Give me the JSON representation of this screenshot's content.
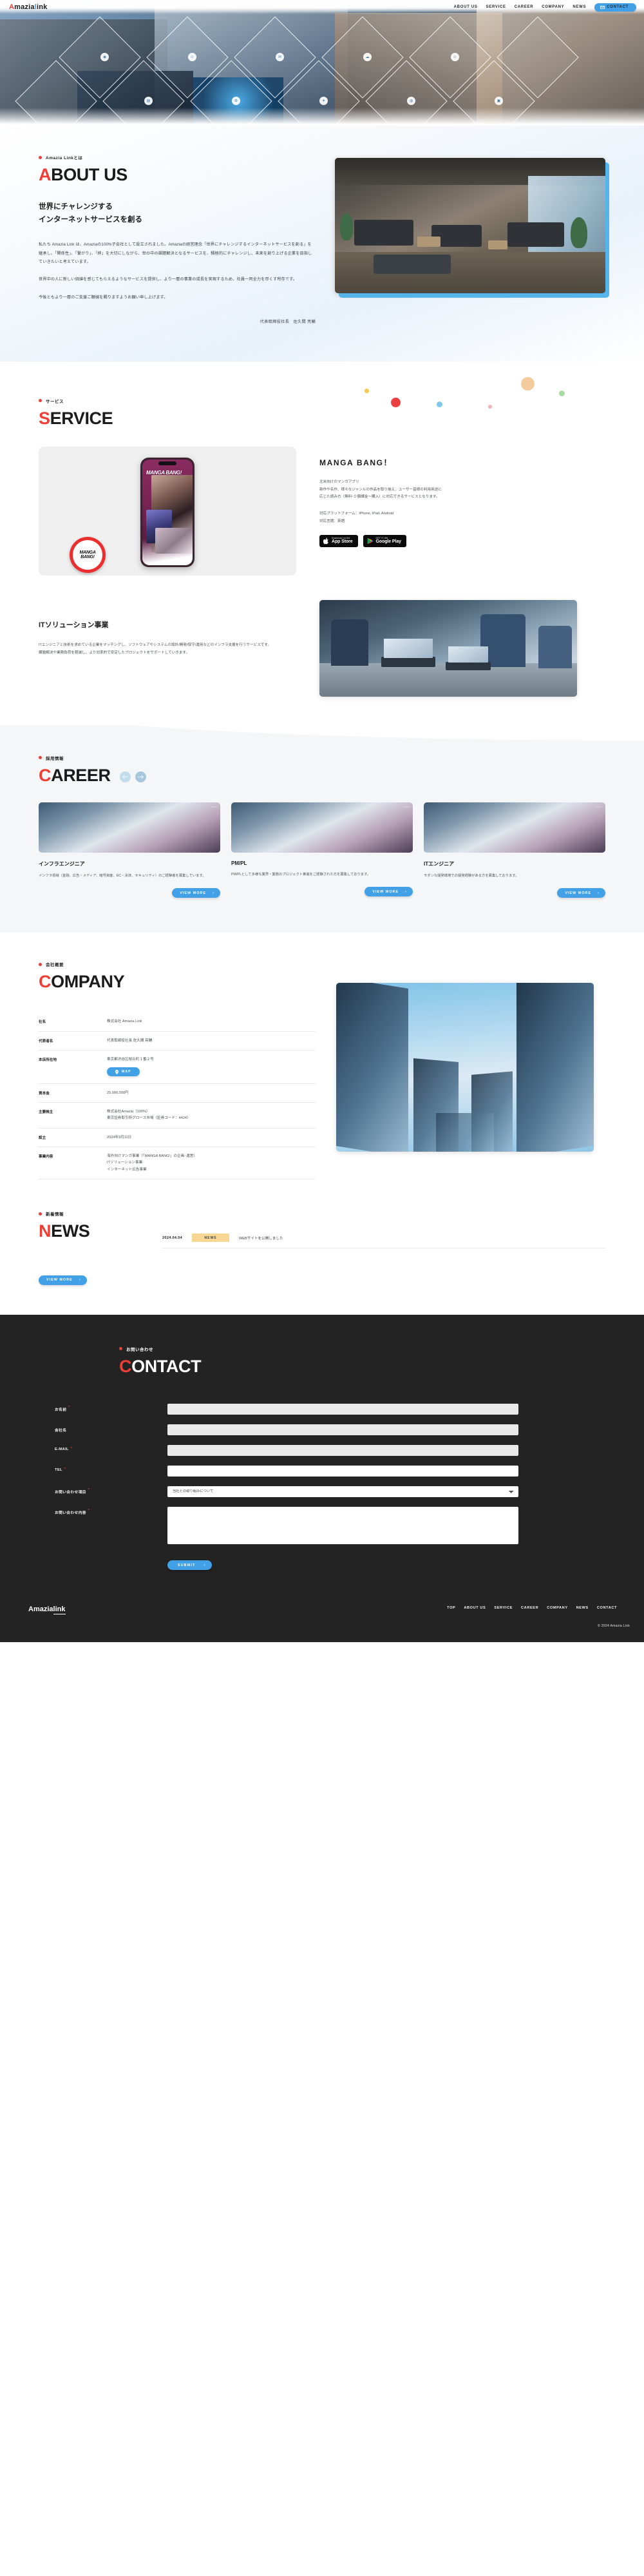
{
  "brand": {
    "part_a": "A",
    "part_mazia": "mazia",
    "part_l": "l",
    "part_ink": "ink",
    "accent_red": "#e8403a",
    "accent_blue": "#41a0e6"
  },
  "header": {
    "nav": [
      {
        "label": "ABOUT US"
      },
      {
        "label": "SERVICE"
      },
      {
        "label": "CAREER"
      },
      {
        "label": "COMPANY"
      },
      {
        "label": "NEWS"
      }
    ],
    "contact_label": "CONTACT"
  },
  "about": {
    "eyebrow": "Amazia Linkとは",
    "title_hl": "A",
    "title_rest": "BOUT US",
    "heading_line1": "世界にチャレンジする",
    "heading_line2": "インターネットサービスを創る",
    "paragraph1": "私たち Amazia Link は、Amaziaの100%子会社として設立されました。Amaziaの経営理念「世界にチャレンジするインターネットサービスを創る」を継承し、「関係性」、「繋がり」、「絆」を大切にしながら、世の中の課題解決となるサービスを、積極的にチャレンジし、未来を創り上げる企業を目指していきたいと考えています。",
    "paragraph2": "世界中の人に新しい価値を感じてもらえるようなサービスを提供し、より一層の事業の成長を実現するため、社員一同全力を尽くす所存です。",
    "paragraph3": "今後ともより一層のご支援ご鞭撻を賜りますようお願い申し上げます。",
    "signature": "代表取締役社長　佐久間 亮輔"
  },
  "service": {
    "eyebrow": "サービス",
    "title_hl": "S",
    "title_rest": "ERVICE",
    "app": {
      "badge_line1": "MANGA",
      "badge_line2": "BANG!",
      "phone_logo": "MANGA BANG!",
      "title": "MANGA BANG！",
      "desc_line1": "北米向けのマンガアプリ",
      "desc_line2": "新作や名作、様々なジャンルの作品を取り揃え、ユーザー皆様の利用用途に",
      "desc_line3": "応じた読み方（無料･少額課金〜購入）に対応できるサービスとなります。",
      "platform": "対応プラットフォーム：iPhone, iPad, Android",
      "language": "対応言語：英語",
      "appstore_small": "Download on the",
      "appstore_big": "App Store",
      "googleplay_small": "GET IT ON",
      "googleplay_big": "Google Play"
    },
    "it": {
      "title": "ITソリューション事業",
      "desc_line1": "ITエンジニアと技術を求めている企業をマッチングし、ソフトウェアやシステムの設計/開発/保守/運用などのインフラ支援を行うサービスです。",
      "desc_line2": "課題解決や業務負荷を軽減し、より効率的で安定したプロジェクトをサポートしていきます。"
    }
  },
  "career": {
    "eyebrow": "採用情報",
    "title_hl": "C",
    "title_rest": "AREER",
    "prev_icon": "arrow-left",
    "next_icon": "arrow-right",
    "view_more": "VIEW MORE",
    "cards": [
      {
        "title": "インフラエンジニア",
        "desc": "インフラ領域（金融、広告・メディア、暗号資産、EC・決済、セキュリティ）のご経験者を募集しています。"
      },
      {
        "title": "PM/PL",
        "desc": "PM/PLとして多様な業界・業態のプロジェクト推進をご経験された方を募集しております。"
      },
      {
        "title": "ITエンジニア",
        "desc": "モダンな開発環境での開発経験がある方を募集しております。"
      }
    ]
  },
  "company": {
    "eyebrow": "会社概要",
    "title_hl": "C",
    "title_rest": "OMPANY",
    "map_label": "MAP",
    "rows": [
      {
        "key": "社名",
        "value": "株式会社 Amazia Link"
      },
      {
        "key": "代表者名",
        "value": "代表取締役社長 佐久間 亮輔"
      },
      {
        "key": "本店所在地",
        "value": "東京都渋谷区桜丘町１番２号",
        "has_map": true
      },
      {
        "key": "資本金",
        "value": "25,000,000円"
      },
      {
        "key": "主要株主",
        "value": "株式会社Amazia（100%）\n東京証券取引所グロース市場（証券コード：4424）"
      },
      {
        "key": "設立",
        "value": "2024年3月11日"
      },
      {
        "key": "事業内容",
        "value": "海外向けマンガ事業（「MANGA BANG!」の企画･運営）\nITソリューション事業\nインターネット広告事業"
      }
    ]
  },
  "news": {
    "eyebrow": "新着情報",
    "title_hl": "N",
    "title_rest": "EWS",
    "view_more": "VIEW MORE",
    "items": [
      {
        "date": "2024.04.04",
        "tag": "NEWS",
        "text": "WEBサイトを公開しました"
      }
    ]
  },
  "contact": {
    "eyebrow": "お問い合わせ",
    "title_hl": "C",
    "title_rest": "ONTACT",
    "fields": [
      {
        "label": "お名前",
        "required": true,
        "type": "text",
        "value": ""
      },
      {
        "label": "会社名",
        "required": false,
        "type": "text",
        "value": ""
      },
      {
        "label": "E-MAIL",
        "required": true,
        "type": "text",
        "value": ""
      },
      {
        "label": "TEL",
        "required": true,
        "type": "text",
        "value": ""
      }
    ],
    "select_label": "お問い合わせ項目",
    "select_value": "当社との取り組みについて",
    "textarea_label": "お問い合わせ内容",
    "textarea_value": "",
    "submit_label": "SUBMIT"
  },
  "footer": {
    "nav": [
      {
        "label": "TOP"
      },
      {
        "label": "ABOUT US"
      },
      {
        "label": "SERVICE"
      },
      {
        "label": "CAREER"
      },
      {
        "label": "COMPANY"
      },
      {
        "label": "NEWS"
      },
      {
        "label": "CONTACT"
      }
    ],
    "copyright": "© 2024 Amazia Link"
  }
}
